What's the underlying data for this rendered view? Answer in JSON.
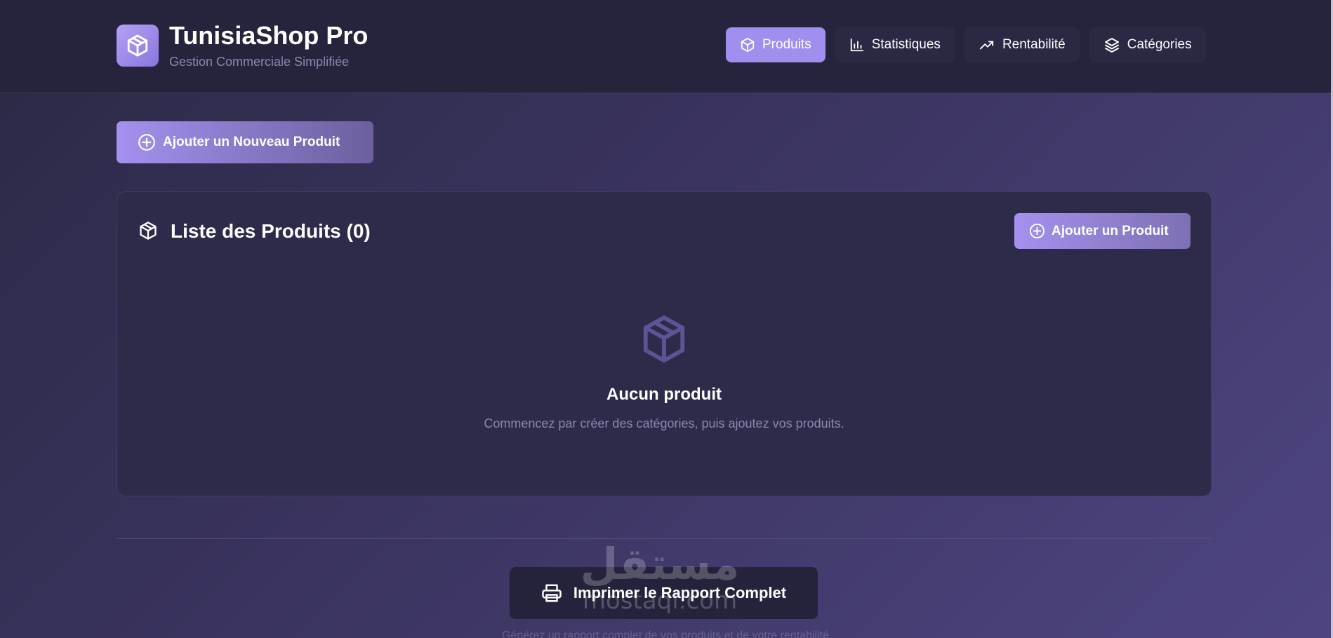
{
  "brand": {
    "title": "TunisiaShop Pro",
    "subtitle": "Gestion Commerciale Simplifiée",
    "logo_icon": "box-icon",
    "accent_color": "#a18ff0"
  },
  "nav": {
    "items": [
      {
        "label": "Produits",
        "icon": "box-icon",
        "active": true
      },
      {
        "label": "Statistiques",
        "icon": "bar-chart-icon",
        "active": false
      },
      {
        "label": "Rentabilité",
        "icon": "trending-up-icon",
        "active": false
      },
      {
        "label": "Catégories",
        "icon": "layers-icon",
        "active": false
      }
    ]
  },
  "actions": {
    "add_new_product_label": "Ajouter un Nouveau Produit"
  },
  "product_list": {
    "title": "Liste des Produits (0)",
    "add_button_label": "Ajouter un Produit",
    "empty_title": "Aucun produit",
    "empty_message": "Commencez par créer des catégories, puis ajoutez vos produits."
  },
  "footer": {
    "print_button_label": "Imprimer le Rapport Complet",
    "note": "Générez un rapport complet de vos produits et de votre rentabilité"
  },
  "watermark": {
    "arabic": "مستقل",
    "latin": "mostaql.com"
  }
}
